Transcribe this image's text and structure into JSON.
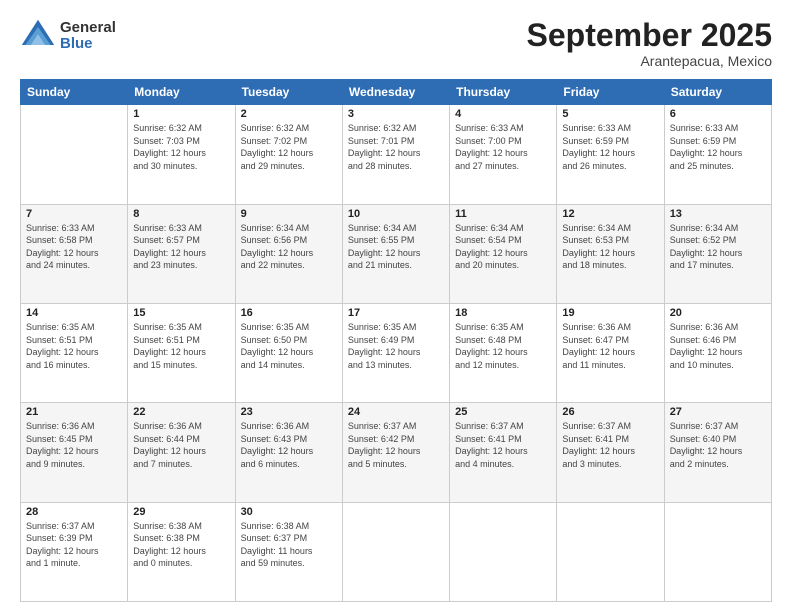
{
  "logo": {
    "general": "General",
    "blue": "Blue"
  },
  "header": {
    "month": "September 2025",
    "location": "Arantepacua, Mexico"
  },
  "days_of_week": [
    "Sunday",
    "Monday",
    "Tuesday",
    "Wednesday",
    "Thursday",
    "Friday",
    "Saturday"
  ],
  "weeks": [
    [
      {
        "day": "",
        "info": ""
      },
      {
        "day": "1",
        "info": "Sunrise: 6:32 AM\nSunset: 7:03 PM\nDaylight: 12 hours\nand 30 minutes."
      },
      {
        "day": "2",
        "info": "Sunrise: 6:32 AM\nSunset: 7:02 PM\nDaylight: 12 hours\nand 29 minutes."
      },
      {
        "day": "3",
        "info": "Sunrise: 6:32 AM\nSunset: 7:01 PM\nDaylight: 12 hours\nand 28 minutes."
      },
      {
        "day": "4",
        "info": "Sunrise: 6:33 AM\nSunset: 7:00 PM\nDaylight: 12 hours\nand 27 minutes."
      },
      {
        "day": "5",
        "info": "Sunrise: 6:33 AM\nSunset: 6:59 PM\nDaylight: 12 hours\nand 26 minutes."
      },
      {
        "day": "6",
        "info": "Sunrise: 6:33 AM\nSunset: 6:59 PM\nDaylight: 12 hours\nand 25 minutes."
      }
    ],
    [
      {
        "day": "7",
        "info": "Sunrise: 6:33 AM\nSunset: 6:58 PM\nDaylight: 12 hours\nand 24 minutes."
      },
      {
        "day": "8",
        "info": "Sunrise: 6:33 AM\nSunset: 6:57 PM\nDaylight: 12 hours\nand 23 minutes."
      },
      {
        "day": "9",
        "info": "Sunrise: 6:34 AM\nSunset: 6:56 PM\nDaylight: 12 hours\nand 22 minutes."
      },
      {
        "day": "10",
        "info": "Sunrise: 6:34 AM\nSunset: 6:55 PM\nDaylight: 12 hours\nand 21 minutes."
      },
      {
        "day": "11",
        "info": "Sunrise: 6:34 AM\nSunset: 6:54 PM\nDaylight: 12 hours\nand 20 minutes."
      },
      {
        "day": "12",
        "info": "Sunrise: 6:34 AM\nSunset: 6:53 PM\nDaylight: 12 hours\nand 18 minutes."
      },
      {
        "day": "13",
        "info": "Sunrise: 6:34 AM\nSunset: 6:52 PM\nDaylight: 12 hours\nand 17 minutes."
      }
    ],
    [
      {
        "day": "14",
        "info": "Sunrise: 6:35 AM\nSunset: 6:51 PM\nDaylight: 12 hours\nand 16 minutes."
      },
      {
        "day": "15",
        "info": "Sunrise: 6:35 AM\nSunset: 6:51 PM\nDaylight: 12 hours\nand 15 minutes."
      },
      {
        "day": "16",
        "info": "Sunrise: 6:35 AM\nSunset: 6:50 PM\nDaylight: 12 hours\nand 14 minutes."
      },
      {
        "day": "17",
        "info": "Sunrise: 6:35 AM\nSunset: 6:49 PM\nDaylight: 12 hours\nand 13 minutes."
      },
      {
        "day": "18",
        "info": "Sunrise: 6:35 AM\nSunset: 6:48 PM\nDaylight: 12 hours\nand 12 minutes."
      },
      {
        "day": "19",
        "info": "Sunrise: 6:36 AM\nSunset: 6:47 PM\nDaylight: 12 hours\nand 11 minutes."
      },
      {
        "day": "20",
        "info": "Sunrise: 6:36 AM\nSunset: 6:46 PM\nDaylight: 12 hours\nand 10 minutes."
      }
    ],
    [
      {
        "day": "21",
        "info": "Sunrise: 6:36 AM\nSunset: 6:45 PM\nDaylight: 12 hours\nand 9 minutes."
      },
      {
        "day": "22",
        "info": "Sunrise: 6:36 AM\nSunset: 6:44 PM\nDaylight: 12 hours\nand 7 minutes."
      },
      {
        "day": "23",
        "info": "Sunrise: 6:36 AM\nSunset: 6:43 PM\nDaylight: 12 hours\nand 6 minutes."
      },
      {
        "day": "24",
        "info": "Sunrise: 6:37 AM\nSunset: 6:42 PM\nDaylight: 12 hours\nand 5 minutes."
      },
      {
        "day": "25",
        "info": "Sunrise: 6:37 AM\nSunset: 6:41 PM\nDaylight: 12 hours\nand 4 minutes."
      },
      {
        "day": "26",
        "info": "Sunrise: 6:37 AM\nSunset: 6:41 PM\nDaylight: 12 hours\nand 3 minutes."
      },
      {
        "day": "27",
        "info": "Sunrise: 6:37 AM\nSunset: 6:40 PM\nDaylight: 12 hours\nand 2 minutes."
      }
    ],
    [
      {
        "day": "28",
        "info": "Sunrise: 6:37 AM\nSunset: 6:39 PM\nDaylight: 12 hours\nand 1 minute."
      },
      {
        "day": "29",
        "info": "Sunrise: 6:38 AM\nSunset: 6:38 PM\nDaylight: 12 hours\nand 0 minutes."
      },
      {
        "day": "30",
        "info": "Sunrise: 6:38 AM\nSunset: 6:37 PM\nDaylight: 11 hours\nand 59 minutes."
      },
      {
        "day": "",
        "info": ""
      },
      {
        "day": "",
        "info": ""
      },
      {
        "day": "",
        "info": ""
      },
      {
        "day": "",
        "info": ""
      }
    ]
  ]
}
